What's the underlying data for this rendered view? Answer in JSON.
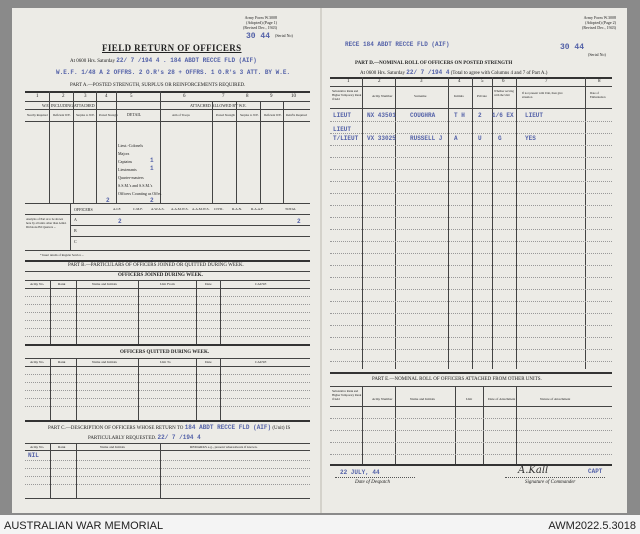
{
  "left": {
    "form_ref": [
      "Army Form W.3008",
      "(Adopted) (Page 1)",
      "(Revised Dec., 1943)"
    ],
    "serial": "30 44",
    "serial_label": "(Serial No)",
    "title": "FIELD RETURN OF OFFICERS",
    "at_line_prefix": "At 0600 Hrs. Saturday",
    "at_date": "22/ 7 /194 4 . ",
    "at_unit": "184 ABDT RECCE FLD (AIF)",
    "wef_line": "W.E.F. 1/48 A 2 OFFRS. 2 O.R's 28 + OFFRS. 1 O.R's 3 ATT. BY W.E.",
    "part_a": "PART A.—POSTED STRENGTH, SURPLUS OR REINFORCEMENTS REQUIRED.",
    "col_nums": [
      "1",
      "2",
      "3",
      "4",
      "5",
      "6",
      "7",
      "8",
      "9",
      "10"
    ],
    "we_excl": "W.E. INCLUDING ATTACHED",
    "attached_we": "ATTACHED ALLOWED BY W.E.",
    "col_heads": [
      "Nearby Required",
      "Deficient W.E.",
      "Surplus to W.E.",
      "Posted Strength",
      "DETAIL",
      "Arm of Troops",
      "Posted Strength",
      "Surplus to W.E.",
      "Deficient W.E.",
      "Reinf'ts Required"
    ],
    "ranks": [
      "Lieut.-Colonels",
      "Majors",
      "Captains",
      "Lieutenants",
      "Quarter-masters",
      "S.S.M.'s and S.S.M.'s",
      "Officers Counting as Offrs."
    ],
    "rank_vals": [
      "1",
      "1"
    ],
    "tot_left": "2",
    "tot_mid": "2",
    "tot_right": "2",
    "arms_heads": [
      "OFFICERS",
      "A.I.F.",
      "C.M.F.",
      "A.W.A.S.",
      "A.A.M.W.S.",
      "A.A.M.W.S.",
      "CIVIL",
      "R.A.N.",
      "R.A.A.F.",
      "TOTAL"
    ],
    "analysis_note": "Analysis of Part A to be shown here by all units other than Armd. Divisions Hd Quarters ...",
    "an_rows": [
      "A",
      "B",
      "C"
    ],
    "an_val": "2",
    "an_total": "2",
    "footnote": "* Insert details of Regular Service ...",
    "part_b": "PART B.—PARTICULARS OF OFFICERS JOINED OR QUITTED DURING WEEK.",
    "joined": "OFFICERS JOINED DURING WEEK.",
    "joined_heads": [
      "Army No.",
      "Rank",
      "Name and Initials",
      "Unit From",
      "Date",
      "CAUSE"
    ],
    "quitted": "OFFICERS QUITTED DURING WEEK.",
    "quitted_heads": [
      "Army No.",
      "Rank",
      "Name and Initials",
      "Unit To",
      "Date",
      "CAUSE"
    ],
    "part_c": "PART C.—DESCRIPTION OF OFFICERS WHOSE RETURN TO",
    "part_c_unit": "184 ABDT RECCE FLD (AIF)",
    "part_c_unit_label": "(Unit) IS",
    "part_c_2": "PARTICULARLY REQUESTED.",
    "part_c_date": "22/ 7 /194 4",
    "part_c_heads": [
      "Army No.",
      "Rank",
      "Name and Initials",
      "REMARKS e.g., present whereabouts if known."
    ],
    "nil": "NIL"
  },
  "right": {
    "form_ref": [
      "Army Form W.3008",
      "(Adopted) (Page 2)",
      "(Revised Dec., 1943)"
    ],
    "unit_top": "RECE 184 ABDT RECCE FLD (AIF)",
    "serial": "30 44",
    "serial_label": "(Serial No)",
    "part_d": "PART D.—NOMINAL ROLL OF OFFICERS ON POSTED STRENGTH",
    "at_line": "At 0600 Hrs. Saturday",
    "at_date": "22/ 7 /194 4",
    "at_note": "(Total to agree with Columns 4 and 7 of Part A.)",
    "col_nums": [
      "1",
      "2",
      "3",
      "4",
      "5",
      "6",
      "7",
      "8"
    ],
    "d_heads": [
      "Substantive Rank and Higher Temporary Rank if held",
      "Army Number",
      "Surname",
      "Initials",
      "Private",
      "Whether serving with the Unit",
      "If not present with Unit, then give situation",
      "Date of Embarkation"
    ],
    "rows": [
      {
        "rank": "LIEUT",
        "num": "NX 43501",
        "name": "COUGHRA",
        "init": "T H",
        "n1": "2",
        "n2": "1/6 EX",
        "rem": "LIEUT"
      },
      {
        "rank": "LIEUT",
        "num": "",
        "name": "",
        "init": "",
        "n1": "",
        "n2": "",
        "rem": ""
      },
      {
        "rank": "T/LIEUT",
        "num": "VX 33025",
        "name": "RUSSELL J",
        "init": "A",
        "n1": "U",
        "n2": "G",
        "rem": "YES"
      }
    ],
    "part_e": "PART E.—NOMINAL ROLL OF OFFICERS ATTACHED FROM OTHER UNITS.",
    "e_heads": [
      "Substantive Rank and Higher Temporary Rank if held",
      "Army Number",
      "Name and Initials",
      "Unit",
      "Date of Attachment",
      "Nature of Attachment"
    ],
    "despatch_date": "22 JULY, 44",
    "despatch_label": "Date of Despatch",
    "sig": "A.Kall",
    "sig_rank": "CAPT",
    "sig_label": "Signature of Commander"
  },
  "caption_left": "AUSTRALIAN WAR MEMORIAL",
  "caption_right": "AWM2022.5.3018"
}
